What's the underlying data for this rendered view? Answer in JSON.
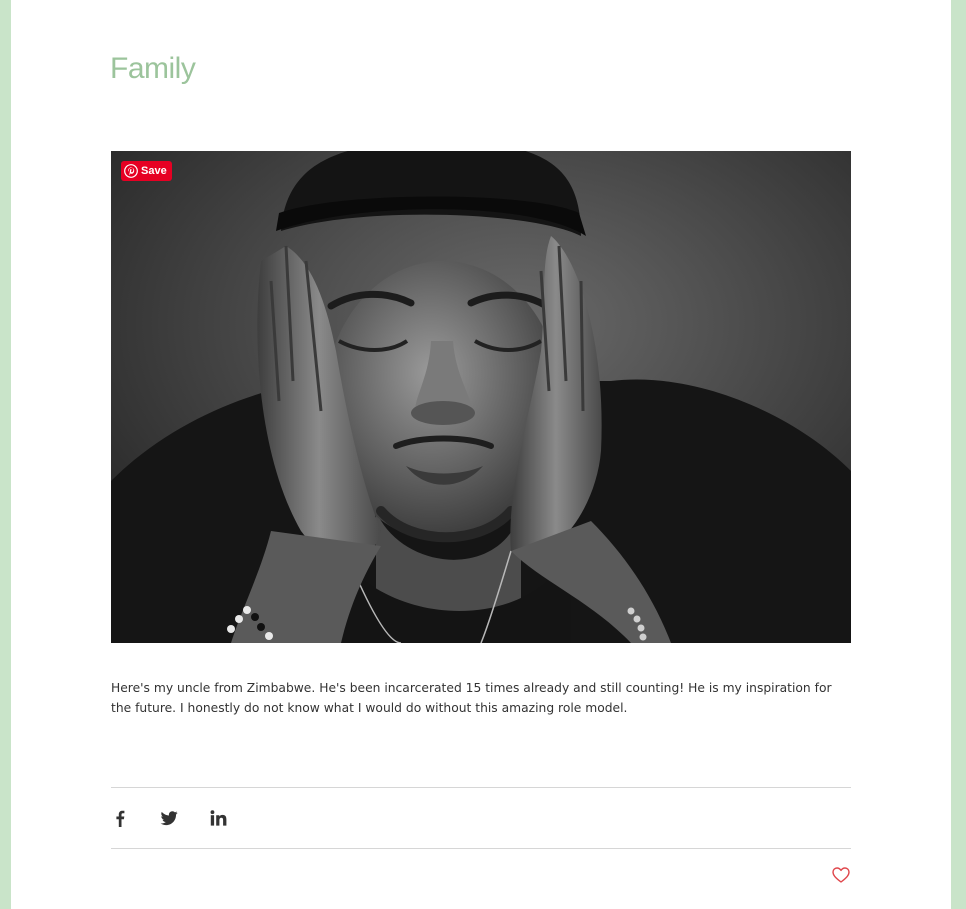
{
  "post": {
    "title": "Family",
    "body": "Here's my uncle from Zimbabwe. He's been incarcerated 15 times already and still counting! He is my inspiration for the future. I honestly do not know what I would do without this amazing role model."
  },
  "image": {
    "description_icon": "photo",
    "pinterest": {
      "label": "Save",
      "icon": "pinterest-icon",
      "color": "#e60023"
    }
  },
  "share": {
    "items": [
      {
        "name": "facebook",
        "icon": "facebook-icon"
      },
      {
        "name": "twitter",
        "icon": "twitter-icon"
      },
      {
        "name": "linkedin",
        "icon": "linkedin-icon"
      }
    ]
  },
  "like": {
    "icon": "heart-icon",
    "color": "#e0474c"
  },
  "theme": {
    "accent": "#9cc49c",
    "frame": "#c9e4c9",
    "text": "#333333"
  }
}
